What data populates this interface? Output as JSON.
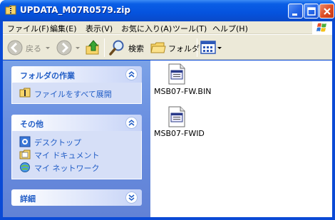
{
  "window": {
    "title": "UPDATA_M07R0579.zip"
  },
  "menu": {
    "items": [
      "ファイル(F)",
      "編集(E)",
      "表示(V)",
      "お気に入り(A)",
      "ツール(T)",
      "ヘルプ(H)"
    ]
  },
  "toolbar": {
    "back_label": "戻る",
    "search_label": "検索",
    "folders_label": "フォルダ"
  },
  "left_pane": {
    "folder_tasks": {
      "title": "フォルダの作業",
      "items": [
        "ファイルをすべて展開"
      ]
    },
    "other_places": {
      "title": "その他",
      "items": [
        "デスクトップ",
        "マイ ドキュメント",
        "マイ ネットワーク"
      ]
    },
    "details": {
      "title": "詳細"
    }
  },
  "files": [
    {
      "name": "MSB07-FW.BIN",
      "icon": "generic-file-icon"
    },
    {
      "name": "MSB07-FWID",
      "icon": "generic-file-icon"
    }
  ],
  "colors": {
    "titlebar": "#0553de",
    "task_pane": "#6a8fe0",
    "link_text": "#215dc6"
  }
}
